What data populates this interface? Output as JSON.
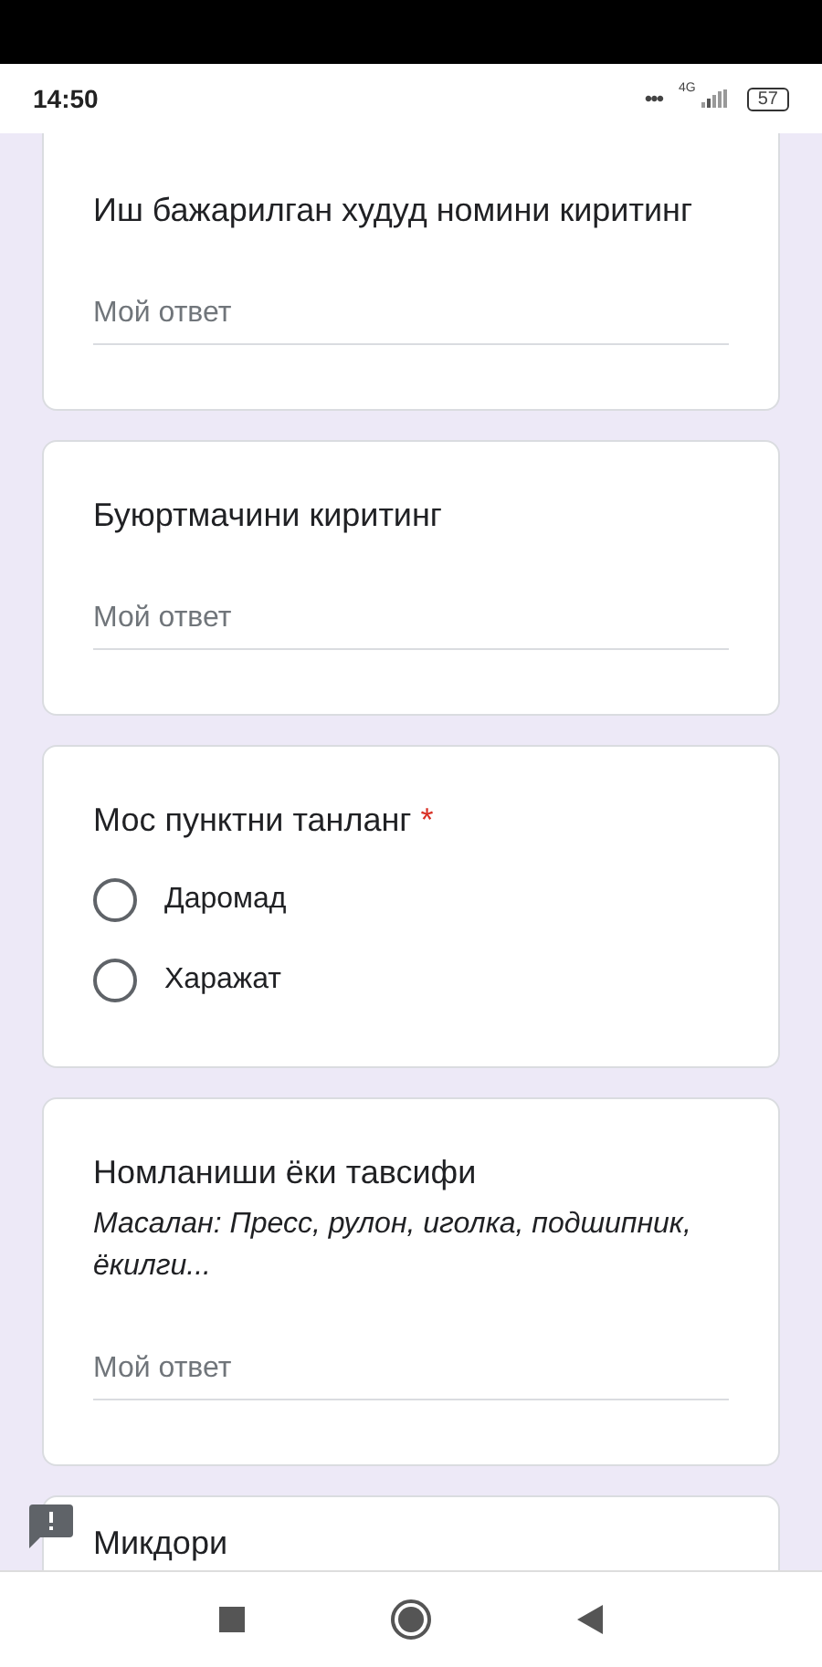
{
  "status_bar": {
    "time": "14:50",
    "more": "•••",
    "network": "4G",
    "battery": "57"
  },
  "questions": [
    {
      "kind": "text",
      "title": "Иш бажарилган худуд номини киритинг",
      "placeholder": "Мой ответ"
    },
    {
      "kind": "text",
      "title": "Буюртмачини киритинг",
      "placeholder": "Мой ответ"
    },
    {
      "kind": "choice",
      "title": "Мос пунктни танланг",
      "required_mark": "*",
      "options": [
        {
          "label": "Даромад",
          "selected": false
        },
        {
          "label": "Харажат",
          "selected": false
        }
      ]
    },
    {
      "kind": "text",
      "title": "Номланиши ёки тавсифи",
      "description": "Масалан: Пресс, рулон, иголка, подшипник, ёкилги...",
      "placeholder": "Мой ответ"
    },
    {
      "kind": "partial",
      "title": "Микдори"
    }
  ]
}
